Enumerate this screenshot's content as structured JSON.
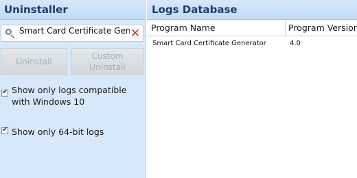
{
  "uninstaller": {
    "title": "Uninstaller",
    "search": {
      "value": "Smart Card Certificate Gene"
    },
    "buttons": {
      "uninstall": "Uninstall",
      "custom_line1": "Custom",
      "custom_line2": "Uninstall"
    },
    "options": [
      {
        "label": "Show only logs compatible with Windows 10",
        "checked": true
      },
      {
        "label": "Show only 64-bit logs",
        "checked": true
      }
    ]
  },
  "logs": {
    "title": "Logs Database",
    "columns": [
      "Program Name",
      "Program Version"
    ],
    "rows": [
      {
        "name": "Smart Card Certificate Generator",
        "version": "4.0"
      }
    ]
  },
  "icons": {
    "search": "search-icon",
    "clear": "clear-icon",
    "checkbox": "checkmark-icon"
  },
  "colors": {
    "accent": "#1c3a70",
    "panel": "#d7e8fa",
    "clear": "#d4281c"
  }
}
